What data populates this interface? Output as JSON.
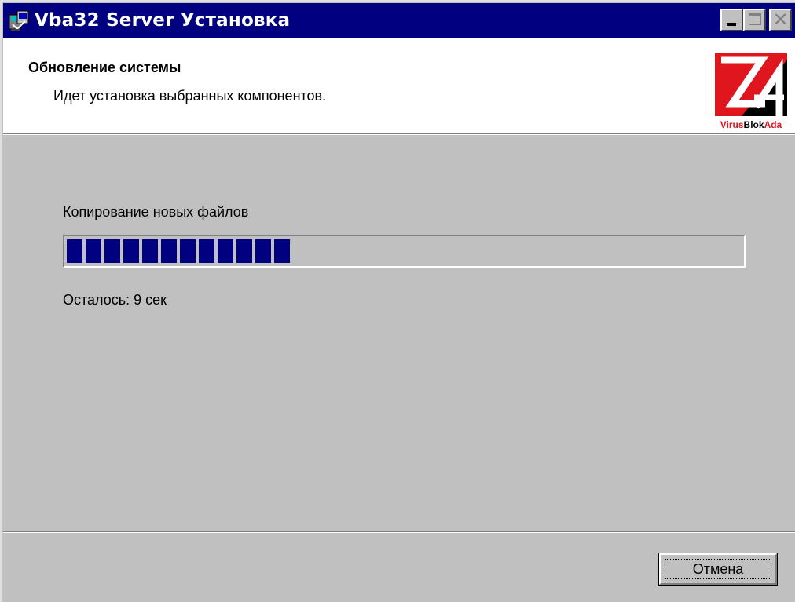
{
  "window": {
    "title": "Vba32 Server Установка",
    "app_icon": "installer-icon",
    "controls": [
      "minimize",
      "maximize",
      "close"
    ]
  },
  "banner": {
    "title": "Обновление системы",
    "subtitle": "Идет установка выбранных компонентов.",
    "logo_text": "VirusBlokAda"
  },
  "progress": {
    "step_label": "Копирование новых файлов",
    "fraction": 0.33,
    "remaining": "Осталось: 9 сек"
  },
  "buttons": {
    "cancel_label": "Отмена"
  },
  "colors": {
    "titlebar": "#000080",
    "progress_fill": "#000080",
    "dialog_bg": "#c0c0c0",
    "logo_red": "#e0161e"
  }
}
